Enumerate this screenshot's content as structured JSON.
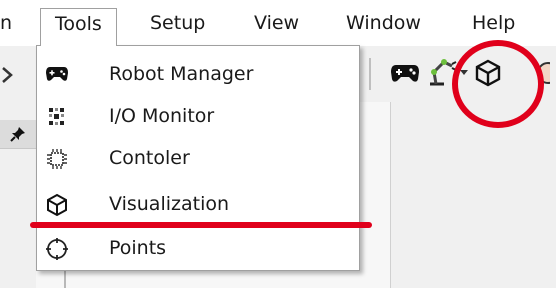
{
  "colors": {
    "annotation": "#e0001b",
    "menu_border": "#a0a0a0",
    "toolbar_bg": "#f0f0f0"
  },
  "menubar": {
    "items": [
      {
        "label": "n"
      },
      {
        "label": "Tools"
      },
      {
        "label": "Setup"
      },
      {
        "label": "View"
      },
      {
        "label": "Window"
      },
      {
        "label": "Help"
      }
    ]
  },
  "tools_menu": {
    "items": [
      {
        "label": "Robot Manager",
        "icon": "gamepad-icon"
      },
      {
        "label": "I/O Monitor",
        "icon": "io-grid-icon"
      },
      {
        "label": "Contoler",
        "icon": "chip-icon"
      },
      {
        "label": "Visualization",
        "icon": "cube-icon"
      },
      {
        "label": "Points",
        "icon": "crosshair-circle-icon"
      }
    ]
  },
  "toolbar": {
    "icons": [
      "gamepad-icon",
      "robot-arm-icon",
      "dropdown-arrow-icon",
      "cube-icon",
      "partial-icon"
    ]
  },
  "annotations": {
    "underline": "red-underline",
    "circle": "red-circle"
  }
}
